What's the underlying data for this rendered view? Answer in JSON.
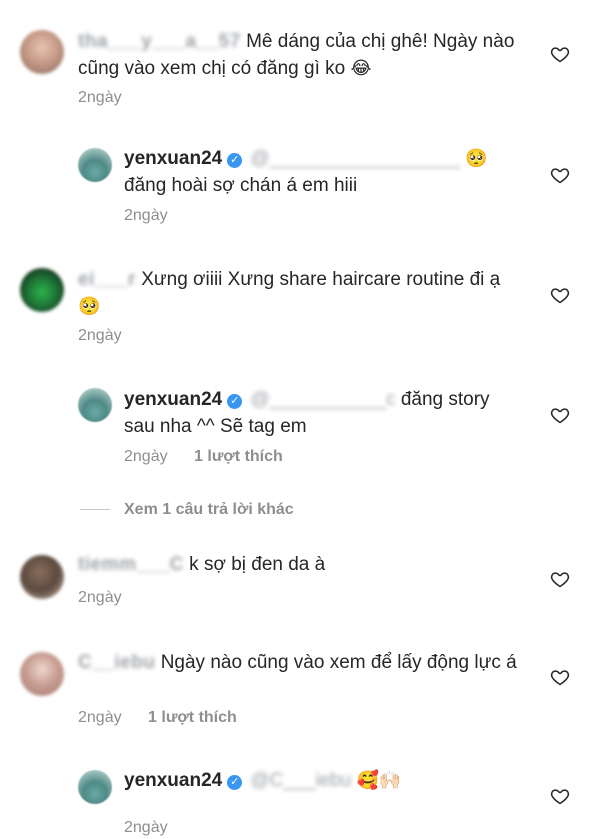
{
  "comments": [
    {
      "user": "tha___y___a__57",
      "text": "Mê dáng của chị ghê! Ngày nào cũng vào xem chị có đăng gì ko",
      "emoji": "😂",
      "time": "2ngày"
    },
    {
      "user": "yenxuan24",
      "mention": "@__________________",
      "emoji": "🥺",
      "text": "đăng hoài sợ chán á em hiii",
      "time": "2ngày"
    },
    {
      "user": "ei___r",
      "text": "Xưng ơiiii Xưng share haircare routine đi ạ",
      "emoji": "🥺",
      "time": "2ngày"
    },
    {
      "user": "yenxuan24",
      "mention": "@___________c",
      "text": "đăng story sau nha ^^ Sẽ tag em",
      "time": "2ngày",
      "likes": "1 lượt thích"
    },
    {
      "user": "tiemm___C",
      "text": "k sợ bị đen da à",
      "time": "2ngày"
    },
    {
      "user": "C__iebu",
      "text": "Ngày nào cũng vào xem để lấy động lực á",
      "time": "2ngày",
      "likes": "1 lượt thích"
    },
    {
      "user": "yenxuan24",
      "mention": "@C___iebu",
      "emoji": "🥰🙌🏻",
      "time": "2ngày"
    }
  ],
  "view_more": "Xem 1 câu trả lời khác",
  "icons": {
    "heart": "heart-outline-icon",
    "verified": "verified-badge-icon"
  },
  "colors": {
    "text": "#262626",
    "meta": "#8e8e8e",
    "verified": "#3897f0"
  }
}
